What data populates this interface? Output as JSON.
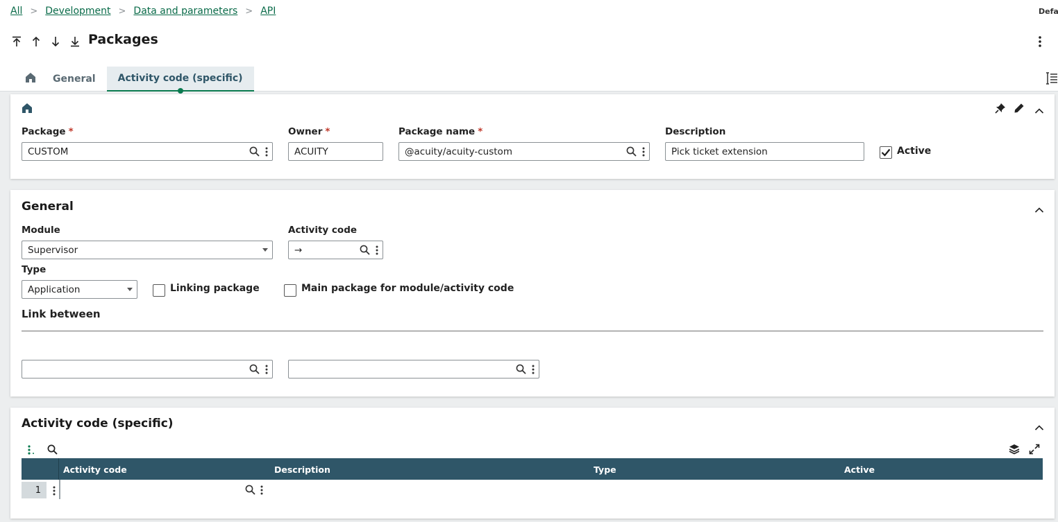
{
  "breadcrumb": {
    "items": [
      "All",
      "Development",
      "Data and parameters",
      "API"
    ],
    "separator": ">"
  },
  "top_right_label": "Defa",
  "page": {
    "title": "Packages"
  },
  "tabs": [
    {
      "label": "General"
    },
    {
      "label": "Activity code (specific)"
    }
  ],
  "header_section": {
    "package": {
      "label": "Package",
      "required": "*",
      "value": "CUSTOM"
    },
    "owner": {
      "label": "Owner",
      "required": "*",
      "value": "ACUITY"
    },
    "package_name": {
      "label": "Package name",
      "required": "*",
      "value": "@acuity/acuity-custom"
    },
    "description": {
      "label": "Description",
      "value": "Pick ticket extension"
    },
    "active": {
      "label": "Active",
      "checked": true
    }
  },
  "general_section": {
    "title": "General",
    "module": {
      "label": "Module",
      "value": "Supervisor"
    },
    "activity_code": {
      "label": "Activity code",
      "value": "→"
    },
    "type": {
      "label": "Type",
      "value": "Application"
    },
    "linking_package": {
      "label": "Linking package",
      "checked": false
    },
    "main_package": {
      "label": "Main package for module/activity code",
      "checked": false
    },
    "link_between": {
      "label": "Link between",
      "field1": "",
      "field2": ""
    }
  },
  "activity_section": {
    "title": "Activity code (specific)",
    "columns": [
      "Activity code",
      "Description",
      "Type",
      "Active"
    ],
    "rows": [
      {
        "num": "1"
      }
    ]
  },
  "colors": {
    "accent": "#0a7a4f",
    "grid_header": "#2f5668",
    "link": "#0a6b49",
    "required": "#c0392b"
  }
}
